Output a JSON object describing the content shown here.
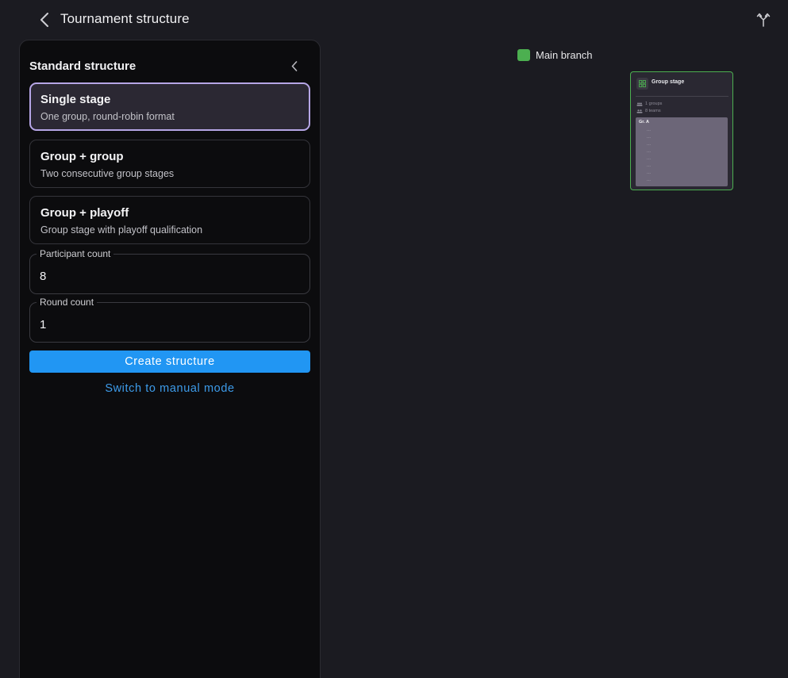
{
  "header": {
    "title": "Tournament structure",
    "back_icon": "chevron-left-icon",
    "branch_icon": "git-fork-icon"
  },
  "panel": {
    "title": "Standard structure",
    "collapse_icon": "chevron-left-icon",
    "options": [
      {
        "title": "Single stage",
        "description": "One group, round-robin format",
        "selected": true
      },
      {
        "title": "Group + group",
        "description": "Two consecutive group stages",
        "selected": false
      },
      {
        "title": "Group + playoff",
        "description": "Group stage with playoff qualification",
        "selected": false
      }
    ],
    "fields": {
      "participant_label": "Participant count",
      "participant_value": "8",
      "round_label": "Round count",
      "round_value": "1"
    },
    "create_label": "Create structure",
    "manual_label": "Switch to manual mode"
  },
  "canvas": {
    "legend_label": "Main branch",
    "legend_color": "#4caf50",
    "stage": {
      "title": "Group stage",
      "groups_text": "1 groups",
      "teams_text": "8 teams",
      "group_label": "Gr. A",
      "slots": [
        "---",
        "---",
        "---",
        "---",
        "---",
        "---",
        "---",
        "---"
      ]
    }
  },
  "colors": {
    "accent": "#2196f3",
    "link": "#3d9be9",
    "selected_border": "#b6a6e6",
    "branch_green": "#4caf50"
  }
}
